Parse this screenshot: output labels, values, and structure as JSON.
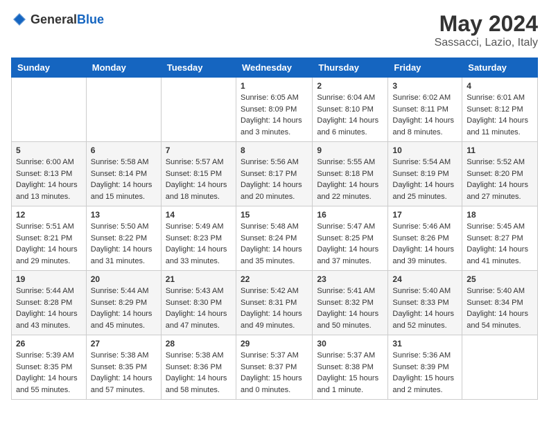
{
  "header": {
    "logo_general": "General",
    "logo_blue": "Blue",
    "title": "May 2024",
    "subtitle": "Sassacci, Lazio, Italy"
  },
  "days_of_week": [
    "Sunday",
    "Monday",
    "Tuesday",
    "Wednesday",
    "Thursday",
    "Friday",
    "Saturday"
  ],
  "weeks": [
    [
      {
        "day": "",
        "info": ""
      },
      {
        "day": "",
        "info": ""
      },
      {
        "day": "",
        "info": ""
      },
      {
        "day": "1",
        "info": "Sunrise: 6:05 AM\nSunset: 8:09 PM\nDaylight: 14 hours\nand 3 minutes."
      },
      {
        "day": "2",
        "info": "Sunrise: 6:04 AM\nSunset: 8:10 PM\nDaylight: 14 hours\nand 6 minutes."
      },
      {
        "day": "3",
        "info": "Sunrise: 6:02 AM\nSunset: 8:11 PM\nDaylight: 14 hours\nand 8 minutes."
      },
      {
        "day": "4",
        "info": "Sunrise: 6:01 AM\nSunset: 8:12 PM\nDaylight: 14 hours\nand 11 minutes."
      }
    ],
    [
      {
        "day": "5",
        "info": "Sunrise: 6:00 AM\nSunset: 8:13 PM\nDaylight: 14 hours\nand 13 minutes."
      },
      {
        "day": "6",
        "info": "Sunrise: 5:58 AM\nSunset: 8:14 PM\nDaylight: 14 hours\nand 15 minutes."
      },
      {
        "day": "7",
        "info": "Sunrise: 5:57 AM\nSunset: 8:15 PM\nDaylight: 14 hours\nand 18 minutes."
      },
      {
        "day": "8",
        "info": "Sunrise: 5:56 AM\nSunset: 8:17 PM\nDaylight: 14 hours\nand 20 minutes."
      },
      {
        "day": "9",
        "info": "Sunrise: 5:55 AM\nSunset: 8:18 PM\nDaylight: 14 hours\nand 22 minutes."
      },
      {
        "day": "10",
        "info": "Sunrise: 5:54 AM\nSunset: 8:19 PM\nDaylight: 14 hours\nand 25 minutes."
      },
      {
        "day": "11",
        "info": "Sunrise: 5:52 AM\nSunset: 8:20 PM\nDaylight: 14 hours\nand 27 minutes."
      }
    ],
    [
      {
        "day": "12",
        "info": "Sunrise: 5:51 AM\nSunset: 8:21 PM\nDaylight: 14 hours\nand 29 minutes."
      },
      {
        "day": "13",
        "info": "Sunrise: 5:50 AM\nSunset: 8:22 PM\nDaylight: 14 hours\nand 31 minutes."
      },
      {
        "day": "14",
        "info": "Sunrise: 5:49 AM\nSunset: 8:23 PM\nDaylight: 14 hours\nand 33 minutes."
      },
      {
        "day": "15",
        "info": "Sunrise: 5:48 AM\nSunset: 8:24 PM\nDaylight: 14 hours\nand 35 minutes."
      },
      {
        "day": "16",
        "info": "Sunrise: 5:47 AM\nSunset: 8:25 PM\nDaylight: 14 hours\nand 37 minutes."
      },
      {
        "day": "17",
        "info": "Sunrise: 5:46 AM\nSunset: 8:26 PM\nDaylight: 14 hours\nand 39 minutes."
      },
      {
        "day": "18",
        "info": "Sunrise: 5:45 AM\nSunset: 8:27 PM\nDaylight: 14 hours\nand 41 minutes."
      }
    ],
    [
      {
        "day": "19",
        "info": "Sunrise: 5:44 AM\nSunset: 8:28 PM\nDaylight: 14 hours\nand 43 minutes."
      },
      {
        "day": "20",
        "info": "Sunrise: 5:44 AM\nSunset: 8:29 PM\nDaylight: 14 hours\nand 45 minutes."
      },
      {
        "day": "21",
        "info": "Sunrise: 5:43 AM\nSunset: 8:30 PM\nDaylight: 14 hours\nand 47 minutes."
      },
      {
        "day": "22",
        "info": "Sunrise: 5:42 AM\nSunset: 8:31 PM\nDaylight: 14 hours\nand 49 minutes."
      },
      {
        "day": "23",
        "info": "Sunrise: 5:41 AM\nSunset: 8:32 PM\nDaylight: 14 hours\nand 50 minutes."
      },
      {
        "day": "24",
        "info": "Sunrise: 5:40 AM\nSunset: 8:33 PM\nDaylight: 14 hours\nand 52 minutes."
      },
      {
        "day": "25",
        "info": "Sunrise: 5:40 AM\nSunset: 8:34 PM\nDaylight: 14 hours\nand 54 minutes."
      }
    ],
    [
      {
        "day": "26",
        "info": "Sunrise: 5:39 AM\nSunset: 8:35 PM\nDaylight: 14 hours\nand 55 minutes."
      },
      {
        "day": "27",
        "info": "Sunrise: 5:38 AM\nSunset: 8:35 PM\nDaylight: 14 hours\nand 57 minutes."
      },
      {
        "day": "28",
        "info": "Sunrise: 5:38 AM\nSunset: 8:36 PM\nDaylight: 14 hours\nand 58 minutes."
      },
      {
        "day": "29",
        "info": "Sunrise: 5:37 AM\nSunset: 8:37 PM\nDaylight: 15 hours\nand 0 minutes."
      },
      {
        "day": "30",
        "info": "Sunrise: 5:37 AM\nSunset: 8:38 PM\nDaylight: 15 hours\nand 1 minute."
      },
      {
        "day": "31",
        "info": "Sunrise: 5:36 AM\nSunset: 8:39 PM\nDaylight: 15 hours\nand 2 minutes."
      },
      {
        "day": "",
        "info": ""
      }
    ]
  ]
}
